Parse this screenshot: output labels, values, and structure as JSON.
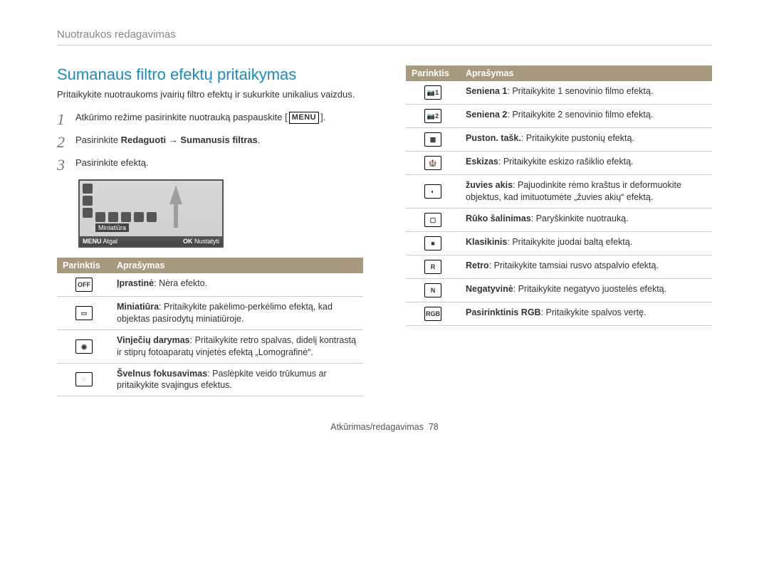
{
  "breadcrumb": "Nuotraukos redagavimas",
  "section_title": "Sumanaus filtro efektų pritaikymas",
  "intro": "Pritaikykite nuotraukoms įvairių filtro efektų ir sukurkite unikalius vaizdus.",
  "step1_a": "Atkūrimo režime pasirinkite nuotrauką paspauskite",
  "step1_menu": "MENU",
  "step1_b": ".",
  "step2_a": "Pasirinkite ",
  "step2_b": "Redaguoti",
  "step2_arrow": " → ",
  "step2_c": "Sumanusis filtras",
  "step2_d": ".",
  "step3": "Pasirinkite efektą.",
  "screenshot": {
    "label": "Miniatiūra",
    "back_key": "MENU",
    "back": "Atgal",
    "ok_key": "OK",
    "ok": "Nustatyti"
  },
  "headers": {
    "option": "Parinktis",
    "description": "Aprašymas"
  },
  "leftTable": [
    {
      "icon": "OFF",
      "name": "Įprastinė",
      "sep": ": ",
      "desc": "Nėra efekto."
    },
    {
      "icon": "▭",
      "name": "Miniatiūra",
      "sep": ": ",
      "desc": "Pritaikykite pakėlimo-perkėlimo efektą, kad objektas pasirodytų miniatiūroje."
    },
    {
      "icon": "◉",
      "name": "Vinječių darymas",
      "sep": ": ",
      "desc": "Pritaikykite retro spalvas, didelį kontrastą ir stiprų fotoaparatų vinjetės efektą „Lomografinė“."
    },
    {
      "icon": "◌",
      "name": "Švelnus fokusavimas",
      "sep": ": ",
      "desc": "Paslėpkite veido trūkumus ar pritaikykite svajingus efektus."
    }
  ],
  "rightTable": [
    {
      "icon": "📷1",
      "name": "Seniena 1",
      "sep": ": ",
      "desc": "Pritaikykite 1 senovinio filmo efektą."
    },
    {
      "icon": "📷2",
      "name": "Seniena 2",
      "sep": ": ",
      "desc": "Pritaikykite 2 senovinio filmo efektą."
    },
    {
      "icon": "▦",
      "name": "Puston. tašk.",
      "sep": ": ",
      "desc": "Pritaikykite pustonių efektą."
    },
    {
      "icon": "🏰",
      "name": "Eskizas",
      "sep": ": ",
      "desc": "Pritaikykite eskizo rašiklio efektą."
    },
    {
      "icon": "◐",
      "name": "žuvies akis",
      "sep": ": ",
      "desc": "Pajuodinkite rėmo kraštus ir deformuokite objektus, kad imituotumėte „žuvies akių“ efektą."
    },
    {
      "icon": "▢",
      "name": "Rūko šalinimas",
      "sep": ": ",
      "desc": "Paryškinkite nuotrauką."
    },
    {
      "icon": "■",
      "name": "Klasikinis",
      "sep": ": ",
      "desc": "Pritaikykite juodai baltą efektą."
    },
    {
      "icon": "R",
      "name": "Retro",
      "sep": ": ",
      "desc": "Pritaikykite tamsiai rusvo atspalvio efektą."
    },
    {
      "icon": "N",
      "name": "Negatyvinė",
      "sep": ": ",
      "desc": "Pritaikykite negatyvo juostelės efektą."
    },
    {
      "icon": "RGB",
      "name": "Pasirinktinis RGB",
      "sep": ": ",
      "desc": "Pritaikykite spalvos vertę."
    }
  ],
  "footer_section": "Atkūrimas/redagavimas",
  "footer_page": "78"
}
